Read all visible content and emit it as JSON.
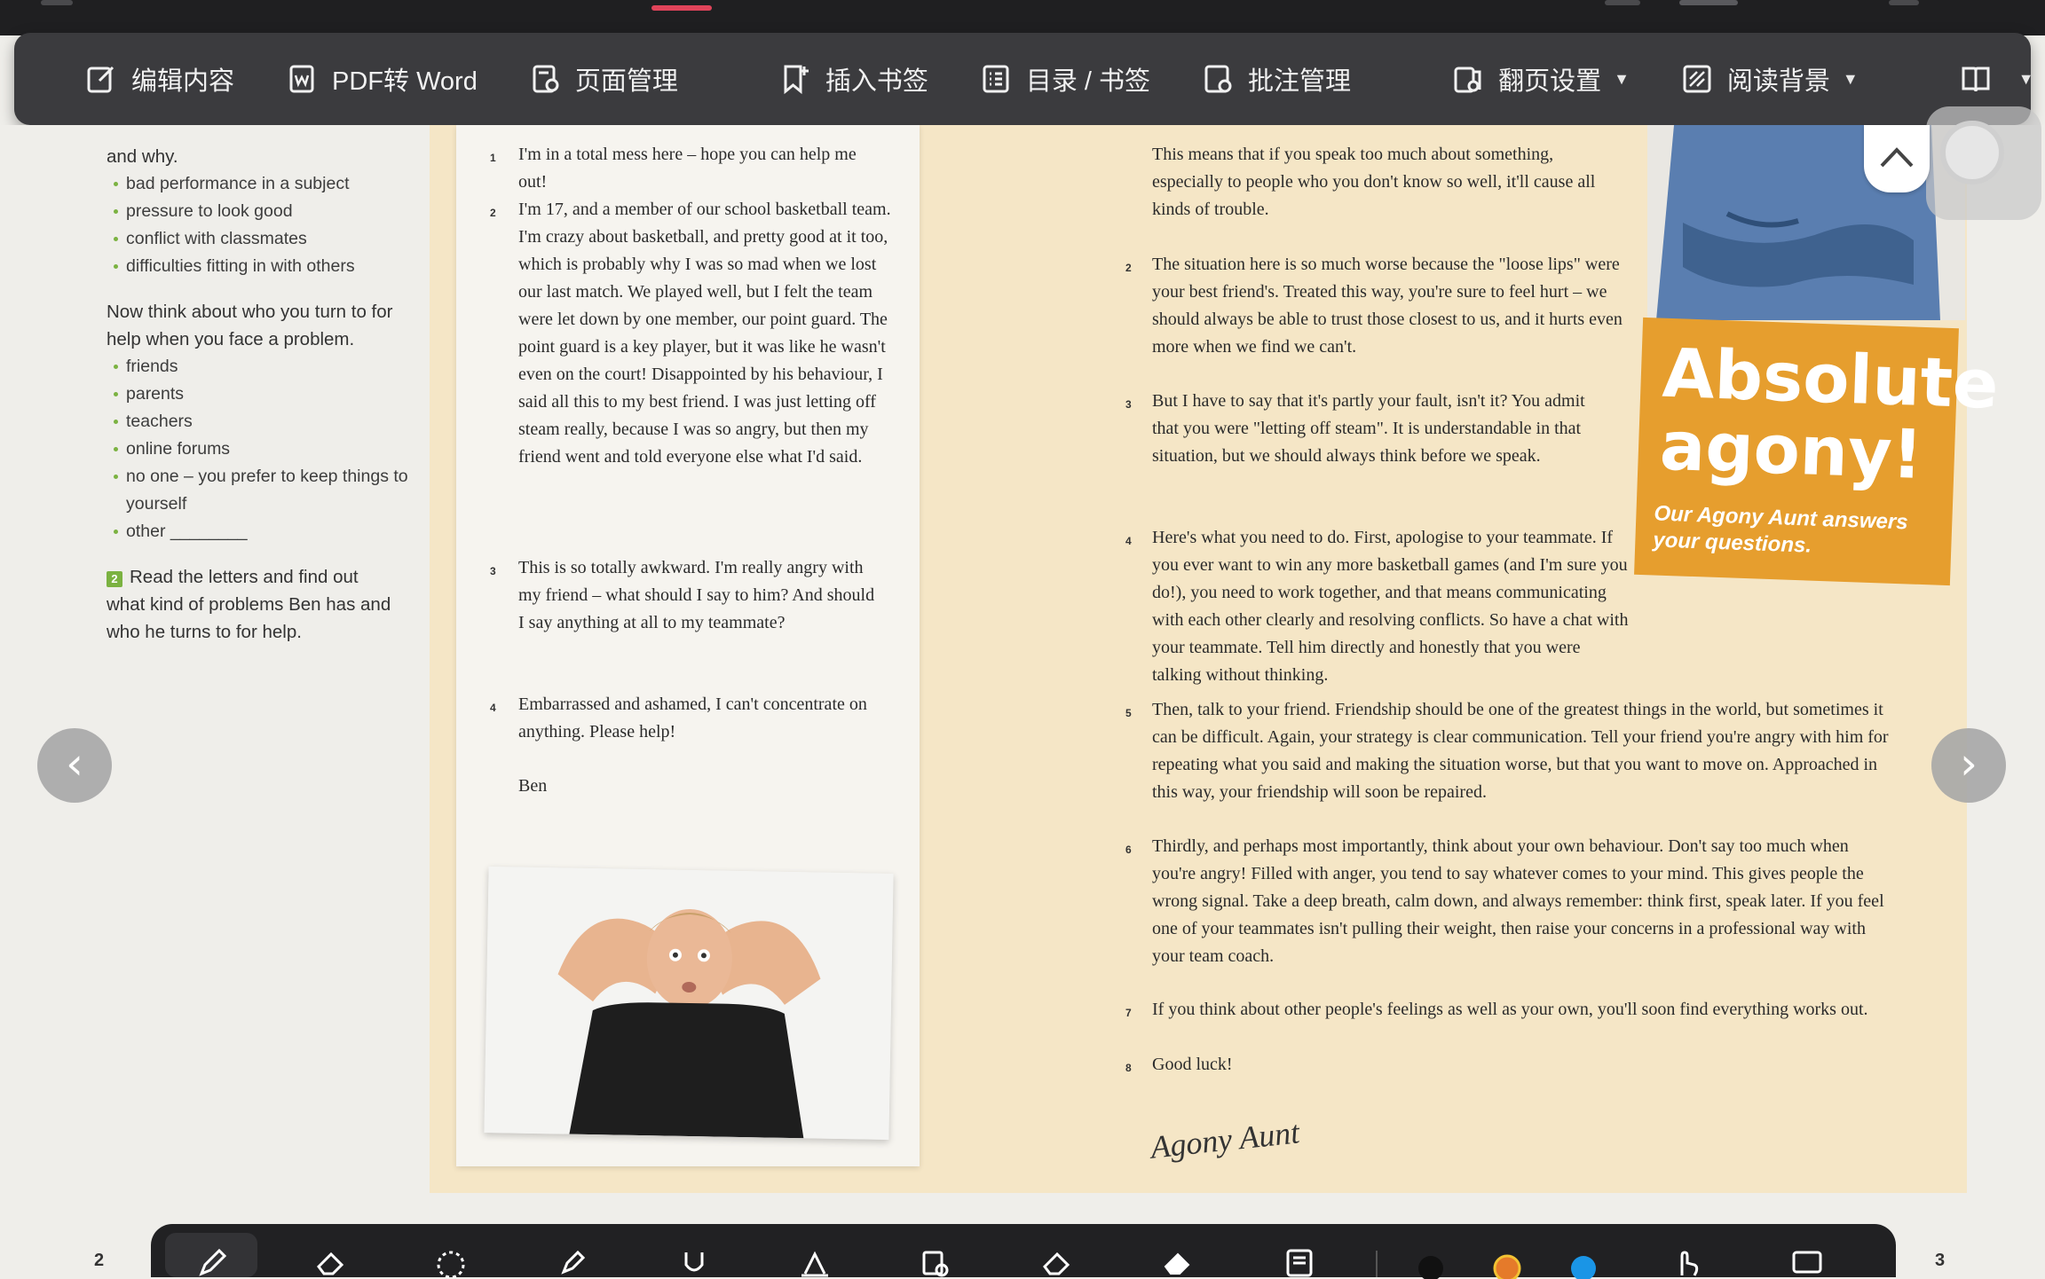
{
  "toolbar": {
    "items": [
      {
        "label": "编辑内容",
        "icon": "edit-icon"
      },
      {
        "label": "PDF转 Word",
        "icon": "pdf-to-word-icon"
      },
      {
        "label": "页面管理",
        "icon": "page-manage-icon"
      },
      {
        "label": "插入书签",
        "icon": "bookmark-add-icon"
      },
      {
        "label": "目录 / 书签",
        "icon": "toc-icon"
      },
      {
        "label": "批注管理",
        "icon": "annotation-icon"
      },
      {
        "label": "翻页设置",
        "icon": "page-turn-icon"
      },
      {
        "label": "阅读背景",
        "icon": "background-icon"
      }
    ]
  },
  "left_column": {
    "intro": "and why.",
    "list1": [
      "bad performance in a subject",
      "pressure to look good",
      "conflict with classmates",
      "difficulties fitting in with others"
    ],
    "question": "Now think about who you turn to for help when you face a problem.",
    "list2": [
      "friends",
      "parents",
      "teachers",
      "online forums",
      "no one – you prefer to keep things to yourself",
      "other ________"
    ],
    "task_number": "2",
    "task": "Read the letters and find out what kind of problems Ben has and who he turns to for help."
  },
  "letter": {
    "paragraphs": [
      {
        "n": "1",
        "text": "I'm in a total mess here – hope you can help me out!"
      },
      {
        "n": "2",
        "text": "I'm 17, and a member of our school basketball team. I'm crazy about basketball, and pretty good at it too, which is probably why I was so mad when we lost our last match. We played well, but I felt the team were let down by one member, our point guard. The point guard is a key player, but it was like he wasn't even on the court! Disappointed by his behaviour, I said all this to my best friend. I was just letting off steam really, because I was so angry, but then my friend went and told everyone else what I'd said."
      },
      {
        "n": "3",
        "text": "This is so totally awkward. I'm really angry with my friend – what should I say to him? And should I say anything at all to my teammate?"
      },
      {
        "n": "4",
        "text": "Embarrassed and ashamed, I can't concentrate on anything. Please help!"
      }
    ],
    "signoff": "Ben"
  },
  "reply": {
    "paragraphs": [
      {
        "n": "",
        "text": "This means that if you speak too much about something, especially to people who you don't know so well, it'll cause all kinds of trouble."
      },
      {
        "n": "2",
        "text": "The situation here is so much worse because the \"loose lips\" were your best friend's. Treated this way, you're sure to feel hurt – we should always be able to trust those closest to us, and it hurts even more when we find we can't."
      },
      {
        "n": "3",
        "text": "But I have to say that it's partly your fault, isn't it? You admit that you were \"letting off steam\". It is understandable in that situation, but we should always think before we speak."
      },
      {
        "n": "4",
        "text": "Here's what you need to do. First, apologise to your teammate. If you ever want to win any more basketball games (and I'm sure you do!), you need to work together, and that means communicating with each other clearly and resolving conflicts. So have a chat with your teammate. Tell him directly and honestly that you were talking without thinking."
      },
      {
        "n": "5",
        "text": "Then, talk to your friend. Friendship should be one of the greatest things in the world, but sometimes it can be difficult. Again, your strategy is clear communication. Tell your friend you're angry with him for repeating what you said and making the situation worse, but that you want to move on. Approached in this way, your friendship will soon be repaired."
      },
      {
        "n": "6",
        "text": "Thirdly, and perhaps most importantly, think about your own behaviour. Don't say too much when you're angry! Filled with anger, you tend to say whatever comes to your mind. This gives people the wrong signal. Take a deep breath, calm down, and always remember: think first, speak later. If you feel one of your teammates isn't pulling their weight, then raise your concerns in a professional way with your team coach."
      },
      {
        "n": "7",
        "text": "If you think about other people's feelings as well as your own, you'll soon find everything works out."
      },
      {
        "n": "8",
        "text": "Good luck!"
      }
    ],
    "signature": "Agony Aunt"
  },
  "banner": {
    "line1": "Absolute",
    "line2": "agony!",
    "subtitle": "Our Agony Aunt answers your questions."
  },
  "page_numbers": {
    "left": "2",
    "right": "3"
  },
  "nav": {
    "prev_icon": "chevron-left-icon",
    "next_icon": "chevron-right-icon",
    "up_icon": "chevron-up-icon"
  },
  "bottom_tools": [
    "pen-icon",
    "eraser-icon",
    "lasso-icon",
    "highlighter-icon",
    "underline-icon",
    "text-icon",
    "shape-icon",
    "erase-area-icon",
    "clear-icon",
    "note-icon",
    "color-dot-black",
    "color-dot-orange",
    "color-dot-blue",
    "finger-icon",
    "screen-icon"
  ],
  "colors": {
    "toolbar_bg": "#3b3b3e",
    "page_bg": "#efeeea",
    "tan_bg": "#f5e6c6",
    "banner": "#e69e2e",
    "bullet": "#7bb241",
    "accent_tab": "#e0445a"
  }
}
